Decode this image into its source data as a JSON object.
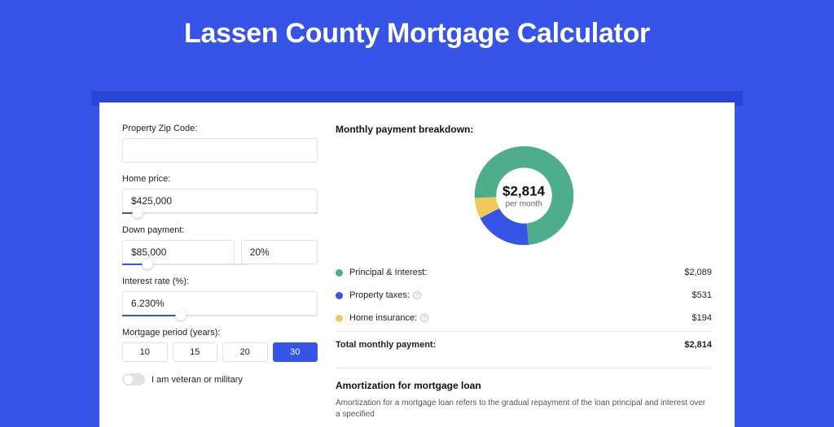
{
  "page_title": "Lassen County Mortgage Calculator",
  "form": {
    "zip_label": "Property Zip Code:",
    "zip_value": "",
    "home_price_label": "Home price:",
    "home_price_value": "$425,000",
    "home_price_slider_pct": 8,
    "down_payment_label": "Down payment:",
    "down_payment_value": "$85,000",
    "down_payment_pct_value": "20%",
    "down_payment_slider_pct": 20,
    "interest_label": "Interest rate (%):",
    "interest_value": "6.230%",
    "interest_slider_pct": 30,
    "period_label": "Mortgage period (years):",
    "period_options": [
      "10",
      "15",
      "20",
      "30"
    ],
    "period_selected": "30",
    "veteran_label": "I am veteran or military",
    "veteran_on": false
  },
  "breakdown": {
    "heading": "Monthly payment breakdown:",
    "donut_amount": "$2,814",
    "donut_sub": "per month",
    "items": [
      {
        "label": "Principal & Interest:",
        "value": "$2,089",
        "color": "#4eae8c",
        "info": false,
        "share": 0.742
      },
      {
        "label": "Property taxes:",
        "value": "$531",
        "color": "#3654e6",
        "info": true,
        "share": 0.189
      },
      {
        "label": "Home insurance:",
        "value": "$194",
        "color": "#f0c95a",
        "info": true,
        "share": 0.069
      }
    ],
    "total_label": "Total monthly payment:",
    "total_value": "$2,814"
  },
  "amortization": {
    "title": "Amortization for mortgage loan",
    "text": "Amortization for a mortgage loan refers to the gradual repayment of the loan principal and interest over a specified"
  },
  "chart_data": {
    "type": "pie",
    "title": "Monthly payment breakdown",
    "categories": [
      "Principal & Interest",
      "Property taxes",
      "Home insurance"
    ],
    "values": [
      2089,
      531,
      194
    ],
    "colors": [
      "#4eae8c",
      "#3654e6",
      "#f0c95a"
    ],
    "total": 2814,
    "center_label": "$2,814 per month"
  }
}
